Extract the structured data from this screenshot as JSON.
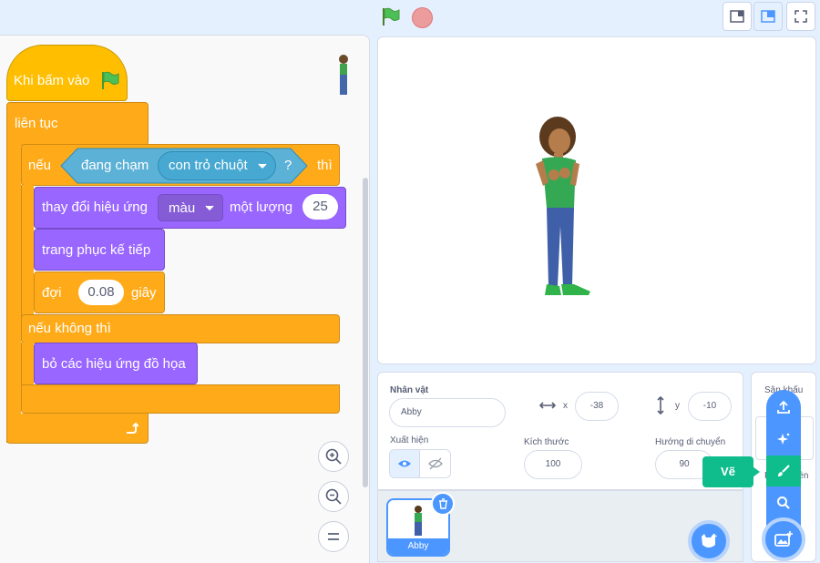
{
  "code": {
    "hat_label": "Khi bấm vào",
    "forever_label": "liên tục",
    "if_label": "nếu",
    "sensing_label": "đang chạm",
    "sensing_menu": "con trỏ chuột",
    "sensing_q": "?",
    "then_label": "thì",
    "change_effect_label": "thay đổi hiệu ứng",
    "effect_menu": "màu",
    "by_label": "một lượng",
    "effect_amount": "25",
    "next_costume_label": "trang phục kế tiếp",
    "wait_label": "đợi",
    "wait_value": "0.08",
    "seconds_label": "giây",
    "else_label": "nếu không thì",
    "clear_effects_label": "bỏ các hiệu ứng đồ họa"
  },
  "sprite_info": {
    "sprite_label": "Nhân vật",
    "sprite_name": "Abby",
    "x_label": "x",
    "x_value": "-38",
    "y_label": "y",
    "y_value": "-10",
    "show_label": "Xuất hiện",
    "size_label": "Kích thước",
    "size_value": "100",
    "direction_label": "Hướng di chuyển",
    "direction_value": "90"
  },
  "sprite_list": {
    "items": [
      {
        "name": "Abby"
      }
    ]
  },
  "backdrop": {
    "title": "Sân khấu",
    "count_label": "Phông nền",
    "tooltip": "Vẽ"
  },
  "colors": {
    "accent": "#4c97ff",
    "events": "#ffbf00",
    "control": "#ffab19",
    "looks": "#9966ff",
    "sensing": "#5cb1d6",
    "extension_green": "#0fbd8c"
  }
}
